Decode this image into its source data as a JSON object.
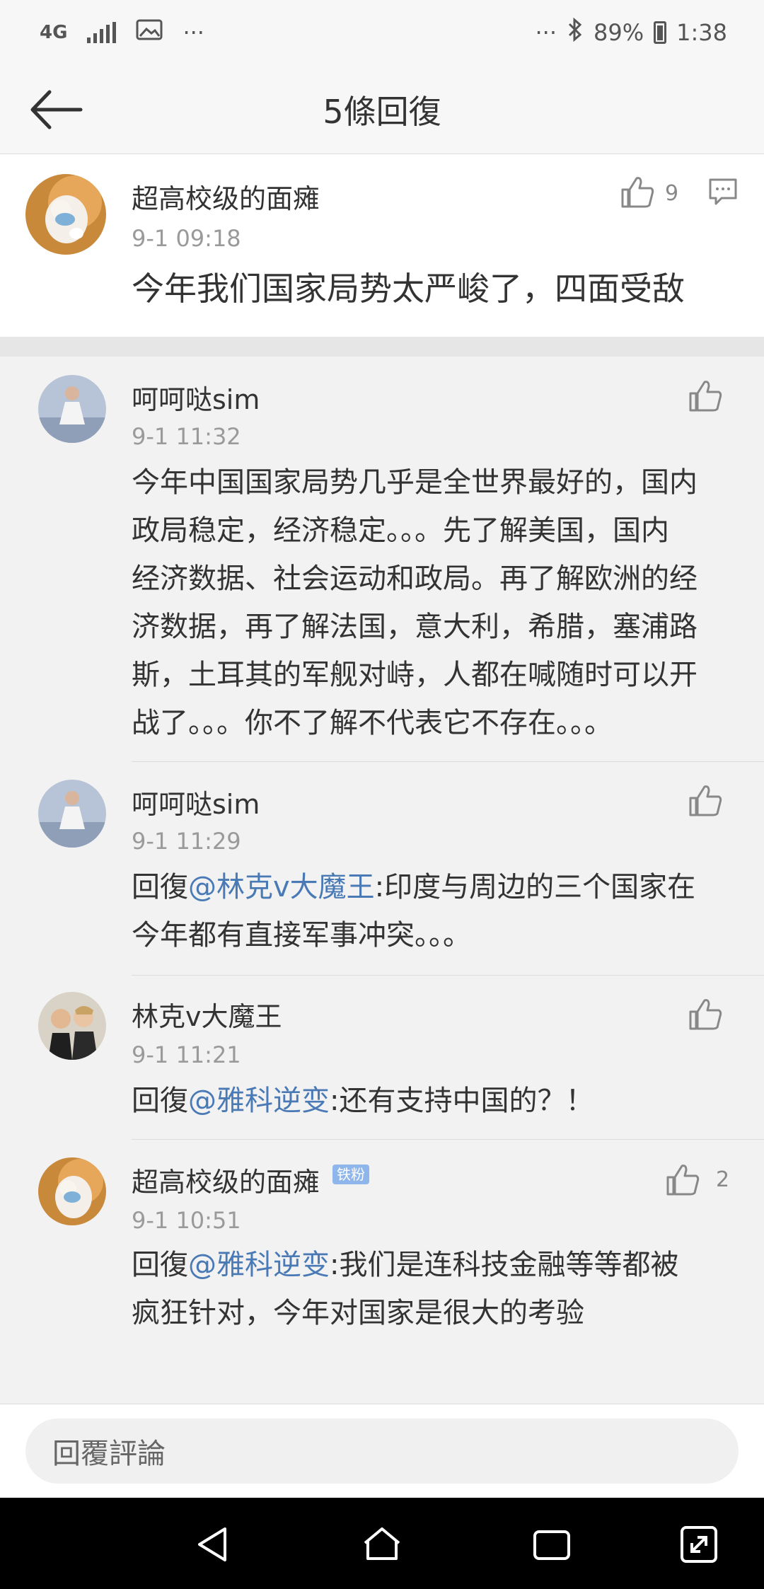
{
  "status_bar": {
    "network": "4G",
    "more_left": "···",
    "more_right": "···",
    "battery": "89%",
    "time": "1:38"
  },
  "header": {
    "title": "5條回復"
  },
  "main_comment": {
    "user": "超高校级的面瘫",
    "time": "9-1 09:18",
    "text": "今年我们国家局势太严峻了，四面受敌",
    "likes": "9"
  },
  "replies": [
    {
      "user": "呵呵哒sim",
      "time": "9-1 11:32",
      "lines": [
        "今年中国国家局势几乎是全世界最好的，国内",
        "政局稳定，经济稳定。。。先了解美国，国内",
        "经济数据、社会运动和政局。再了解欧洲的经",
        "济数据，再了解法国，意大利，希腊，塞浦路",
        "斯，土耳其的军舰对峙，人都在喊随时可以开",
        "战了。。。你不了解不代表它不存在。。。"
      ]
    },
    {
      "user": "呵呵哒sim",
      "time": "9-1 11:29",
      "prefix": "回復",
      "mention": "@林克v大魔王",
      "line1": ":印度与周边的三个国家在",
      "line2": "今年都有直接军事冲突。。。"
    },
    {
      "user": "林克v大魔王",
      "time": "9-1 11:21",
      "prefix": "回復",
      "mention": "@雅科逆变",
      "line1": ":还有支持中国的？！"
    },
    {
      "user": "超高校级的面瘫",
      "badge": "铁粉",
      "time": "9-1 10:51",
      "likes": "2",
      "prefix": "回復",
      "mention": "@雅科逆变",
      "line1": ":我们是连科技金融等等都被",
      "line2": "疯狂针对，今年对国家是很大的考验"
    }
  ],
  "reply_input": {
    "placeholder": "回覆評論"
  }
}
